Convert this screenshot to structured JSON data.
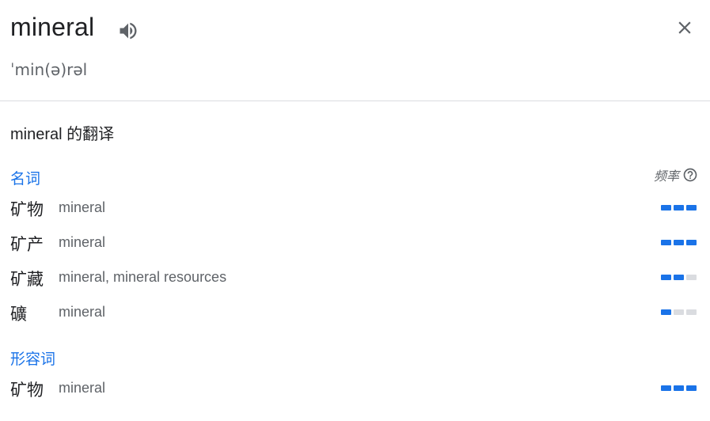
{
  "header": {
    "word": "mineral",
    "phonetic": "ˈmin(ə)rəl",
    "speaker_icon": "volume-up-icon",
    "close_icon": "close-icon"
  },
  "translations": {
    "title": "mineral 的翻译",
    "frequency_label": "频率",
    "help_icon": "help-circle-icon"
  },
  "groups": [
    {
      "pos": "名词",
      "entries": [
        {
          "term": "矿物",
          "synonyms": "mineral",
          "frequency": 3
        },
        {
          "term": "矿产",
          "synonyms": "mineral",
          "frequency": 3
        },
        {
          "term": "矿藏",
          "synonyms": "mineral, mineral resources",
          "frequency": 2
        },
        {
          "term": "礦",
          "synonyms": "mineral",
          "frequency": 1
        }
      ]
    },
    {
      "pos": "形容词",
      "entries": [
        {
          "term": "矿物",
          "synonyms": "mineral",
          "frequency": 3
        }
      ]
    }
  ],
  "colors": {
    "accent": "#1a73e8",
    "bar_off": "#dadce0",
    "text": "#202124",
    "muted": "#5f6368"
  }
}
